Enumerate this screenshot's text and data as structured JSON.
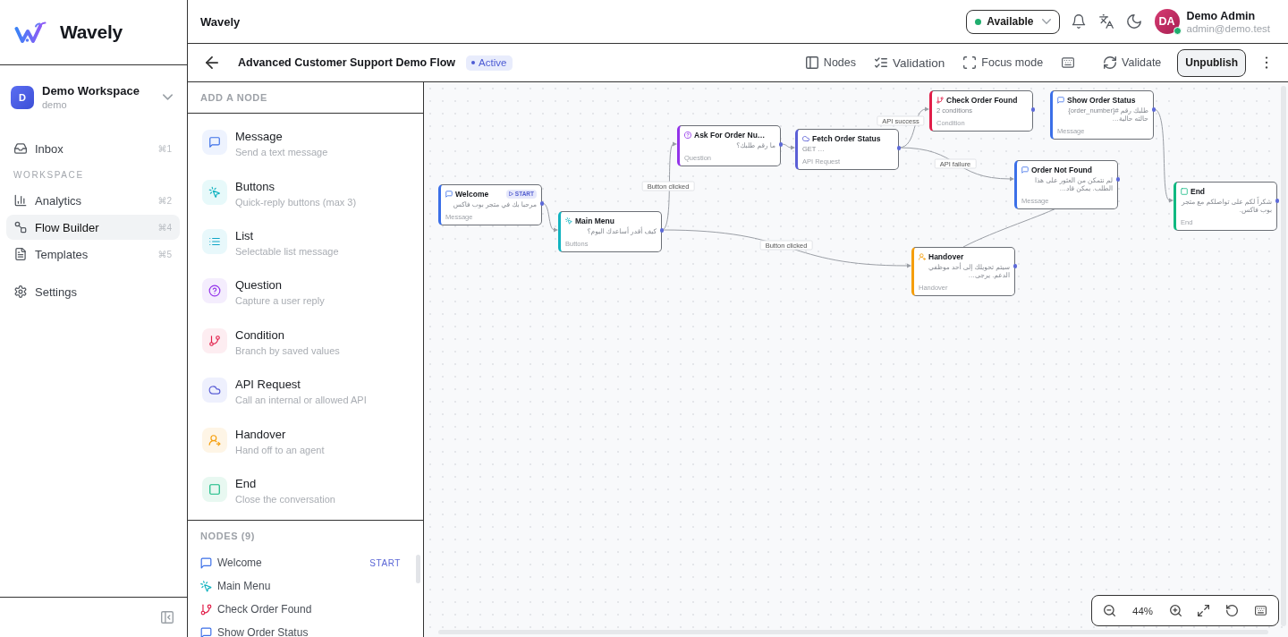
{
  "sidebar": {
    "brand": "Wavely",
    "workspace": {
      "initial": "D",
      "name": "Demo Workspace",
      "slug": "demo"
    },
    "groups": [
      {
        "items": [
          {
            "label": "Inbox",
            "shortcut": "⌘1",
            "selected": false
          }
        ]
      },
      {
        "heading": "WORKSPACE",
        "items": [
          {
            "label": "Analytics",
            "shortcut": "⌘2",
            "selected": false
          },
          {
            "label": "Flow Builder",
            "shortcut": "⌘4",
            "selected": true
          },
          {
            "label": "Templates",
            "shortcut": "⌘5",
            "selected": false
          }
        ]
      },
      {
        "items": [
          {
            "label": "Settings",
            "selected": false
          }
        ]
      }
    ]
  },
  "topbar": {
    "title": "Wavely",
    "status": {
      "label": "Available"
    },
    "user": {
      "initials": "DA",
      "name": "Demo Admin",
      "email": "admin@demo.test"
    }
  },
  "flow": {
    "title": "Advanced Customer Support Demo Flow",
    "status": "Active",
    "tools": [
      "Nodes",
      "Validation",
      "Focus mode"
    ],
    "validate": "Validate",
    "publish_action": "Unpublish"
  },
  "add_node": {
    "heading": "ADD A NODE",
    "types": [
      {
        "kind": "message",
        "name": "Message",
        "description": "Send a text message"
      },
      {
        "kind": "buttons",
        "name": "Buttons",
        "description": "Quick-reply buttons (max 3)"
      },
      {
        "kind": "list",
        "name": "List",
        "description": "Selectable list message"
      },
      {
        "kind": "question",
        "name": "Question",
        "description": "Capture a user reply"
      },
      {
        "kind": "condition",
        "name": "Condition",
        "description": "Branch by saved values"
      },
      {
        "kind": "api",
        "name": "API Request",
        "description": "Call an internal or allowed API"
      },
      {
        "kind": "handover",
        "name": "Handover",
        "description": "Hand off to an agent"
      },
      {
        "kind": "end",
        "name": "End",
        "description": "Close the conversation"
      }
    ]
  },
  "node_list": {
    "heading": "NODES (9)",
    "items": [
      {
        "kind": "message",
        "name": "Welcome",
        "badge": "START"
      },
      {
        "kind": "buttons",
        "name": "Main Menu"
      },
      {
        "kind": "condition",
        "name": "Check Order Found"
      },
      {
        "kind": "message",
        "name": "Show Order Status"
      }
    ]
  },
  "canvas": {
    "nodes": [
      {
        "kind": "message",
        "title": "Welcome",
        "badge": "START",
        "preview": "مرحبا بك في متجر بوب فاكس",
        "type_label": "Message"
      },
      {
        "kind": "buttons",
        "title": "Main Menu",
        "preview": "كيف أقدر أساعدك اليوم؟",
        "type_label": "Buttons"
      },
      {
        "kind": "question",
        "title": "Ask For Order Nu…",
        "preview": "ما رقم طلبك؟",
        "type_label": "Question"
      },
      {
        "kind": "api",
        "title": "Fetch Order Status",
        "preview": "GET …",
        "type_label": "API Request"
      },
      {
        "kind": "condition",
        "title": "Check Order Found",
        "preview": "2 conditions",
        "type_label": "Condition"
      },
      {
        "kind": "handover",
        "title": "Handover",
        "preview": "سيتم تحويلك إلى أحد موظفي الدعم. يرجى…",
        "type_label": "Handover"
      },
      {
        "kind": "message",
        "title": "Order Not Found",
        "preview": "لم نتمكن من العثور على هذا الطلب. يمكن قاد…",
        "type_label": "Message"
      },
      {
        "kind": "message",
        "title": "Show Order Status",
        "preview": "طلبك رقم #{order_number} حالته حالية…",
        "type_label": "Message"
      },
      {
        "kind": "end",
        "title": "End",
        "preview": "شكراً لكم على تواصلكم مع متجر بوب فاكس.",
        "type_label": "End"
      }
    ],
    "edge_labels": [
      "Button clicked",
      "API success",
      "API failure",
      "Button clicked"
    ],
    "zoom": "44%"
  }
}
